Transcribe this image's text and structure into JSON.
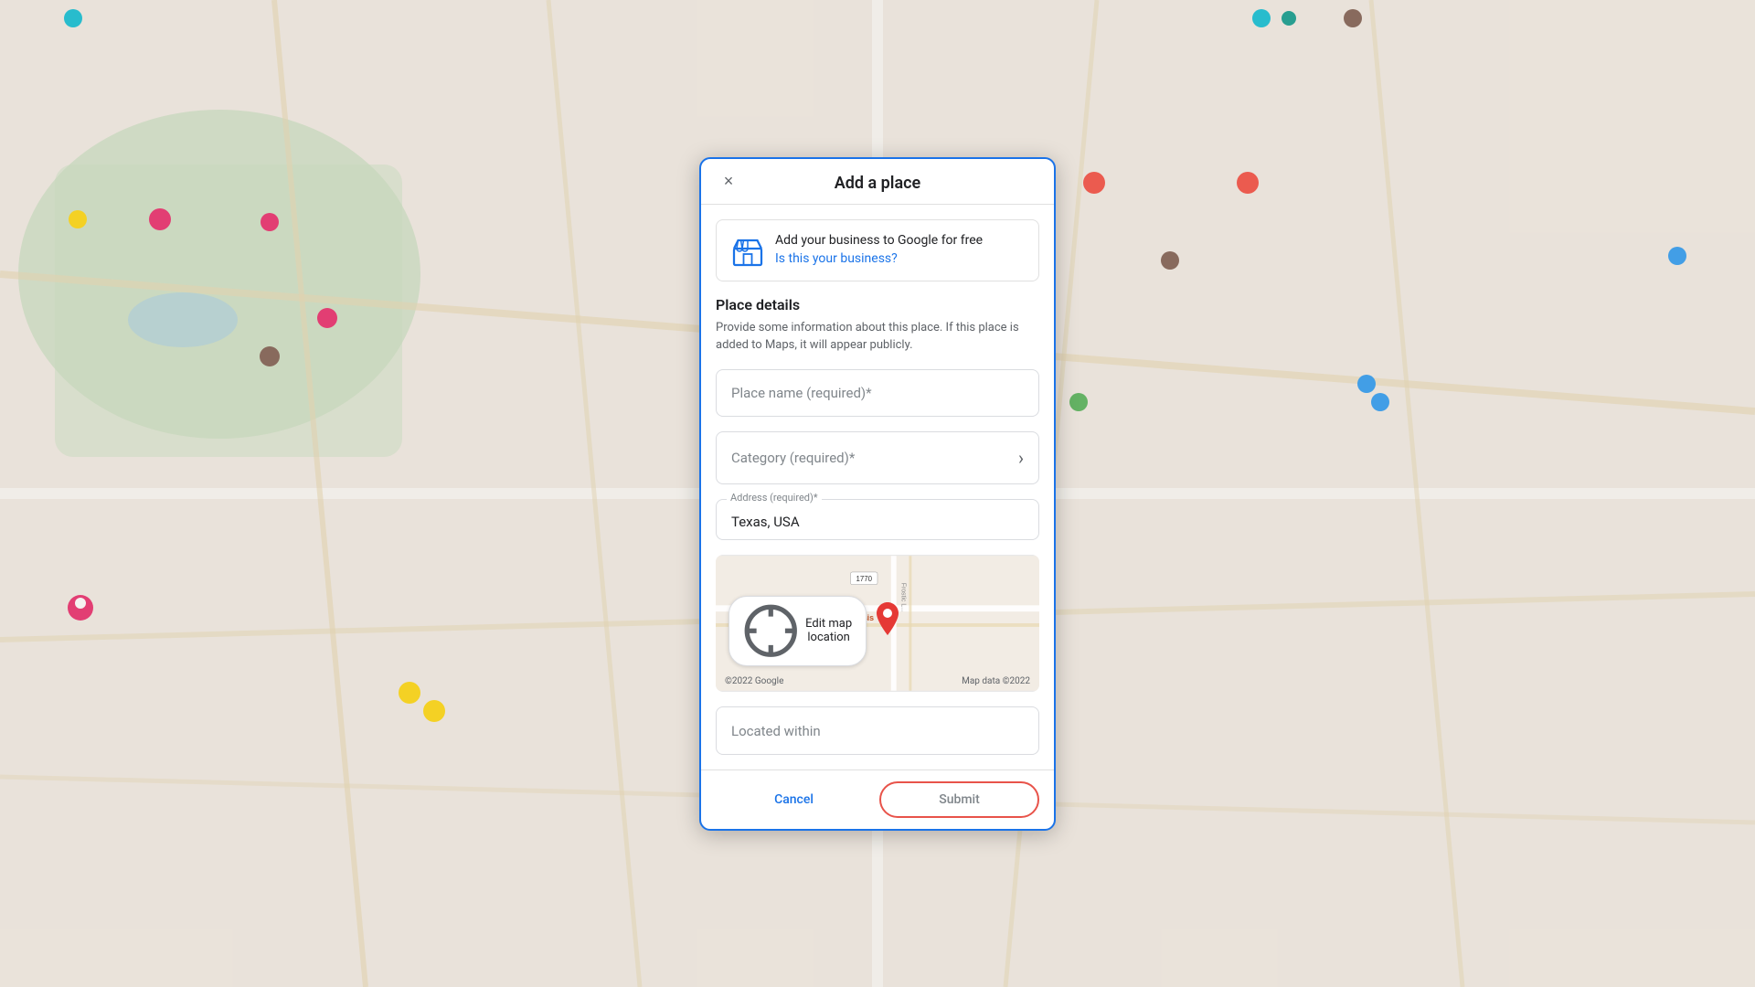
{
  "dialog": {
    "title": "Add a place",
    "close_label": "×"
  },
  "business_card": {
    "title": "Add your business to Google for free",
    "link_text": "Is this your business?",
    "icon": "store-icon"
  },
  "place_details": {
    "heading": "Place details",
    "description": "Provide some information about this place. If this place is added to Maps, it will appear publicly."
  },
  "fields": {
    "place_name_placeholder": "Place name (required)*",
    "category_placeholder": "Category (required)*",
    "address_label": "Address (required)*",
    "address_value": "Texas, USA",
    "located_within_placeholder": "Located within"
  },
  "map_preview": {
    "place_name": "Mirador El Oaasis",
    "road_label": "Frostic L...",
    "road_number": "1770",
    "edit_button": "Edit map location",
    "copyright": "©2022 Google",
    "map_data": "Map data ©2022"
  },
  "footer": {
    "cancel_label": "Cancel",
    "submit_label": "Submit"
  }
}
